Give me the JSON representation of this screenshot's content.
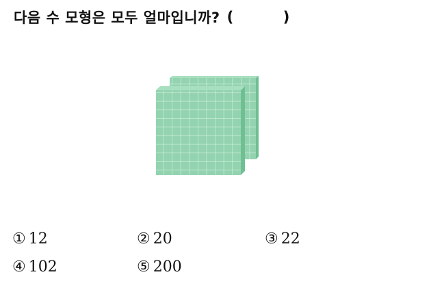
{
  "question": {
    "text": "다음 수 모형은 모두 얼마입니까?",
    "paren_open": "(",
    "paren_close": ")"
  },
  "figure": {
    "description_icon": "hundred-flat-block-icon",
    "block_count": 2,
    "block_color": "#8fd1ad",
    "grid_line_color": "#c9ecd8",
    "side_color": "#6fbf93"
  },
  "choices": [
    {
      "marker": "①",
      "value": "12"
    },
    {
      "marker": "②",
      "value": "20"
    },
    {
      "marker": "③",
      "value": "22"
    },
    {
      "marker": "④",
      "value": "102"
    },
    {
      "marker": "⑤",
      "value": "200"
    }
  ]
}
